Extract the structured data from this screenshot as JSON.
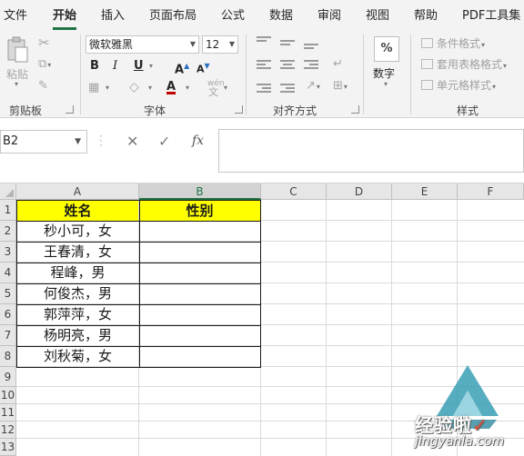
{
  "ribbon": {
    "tabs": [
      {
        "label": "文件",
        "active": false
      },
      {
        "label": "开始",
        "active": true
      },
      {
        "label": "插入",
        "active": false
      },
      {
        "label": "页面布局",
        "active": false
      },
      {
        "label": "公式",
        "active": false
      },
      {
        "label": "数据",
        "active": false
      },
      {
        "label": "审阅",
        "active": false
      },
      {
        "label": "视图",
        "active": false
      },
      {
        "label": "帮助",
        "active": false
      },
      {
        "label": "PDF工具集",
        "active": false
      }
    ],
    "clipboard": {
      "paste_label": "粘贴",
      "group_label": "剪贴板"
    },
    "font": {
      "font_name": "微软雅黑",
      "font_size": "12",
      "bold": "B",
      "italic": "I",
      "underline": "U",
      "grow": "A",
      "shrink": "A",
      "font_color": "A",
      "phonetic": "wén",
      "group_label": "字体"
    },
    "alignment": {
      "group_label": "对齐方式"
    },
    "number": {
      "symbol": "%",
      "label": "数字"
    },
    "styles": {
      "conditional": "条件格式",
      "table_format": "套用表格格式",
      "cell_styles": "单元格样式",
      "group_label": "样式"
    },
    "accent_color": "#217346"
  },
  "formula_bar": {
    "name_box": "B2",
    "cancel_symbol": "✕",
    "enter_symbol": "✓",
    "fx_label": "fx",
    "content": ""
  },
  "sheet": {
    "columns": [
      "A",
      "B",
      "C",
      "D",
      "E",
      "F"
    ],
    "selected_column": "B",
    "rows": [
      "1",
      "2",
      "3",
      "4",
      "5",
      "6",
      "7",
      "8",
      "9",
      "10",
      "11",
      "12",
      "13"
    ],
    "header": {
      "name": "姓名",
      "gender": "性别"
    },
    "header_fill": "#ffff00",
    "data": [
      {
        "name": "秒小可，女",
        "gender": ""
      },
      {
        "name": "王春清，女",
        "gender": ""
      },
      {
        "name": "程峰，男",
        "gender": ""
      },
      {
        "name": "何俊杰，男",
        "gender": ""
      },
      {
        "name": "郭萍萍，女",
        "gender": ""
      },
      {
        "name": "杨明亮，男",
        "gender": ""
      },
      {
        "name": "刘秋菊，女",
        "gender": ""
      }
    ]
  },
  "watermark": {
    "text": "经验啦",
    "check": "✓",
    "url": "jingyanla.com"
  }
}
